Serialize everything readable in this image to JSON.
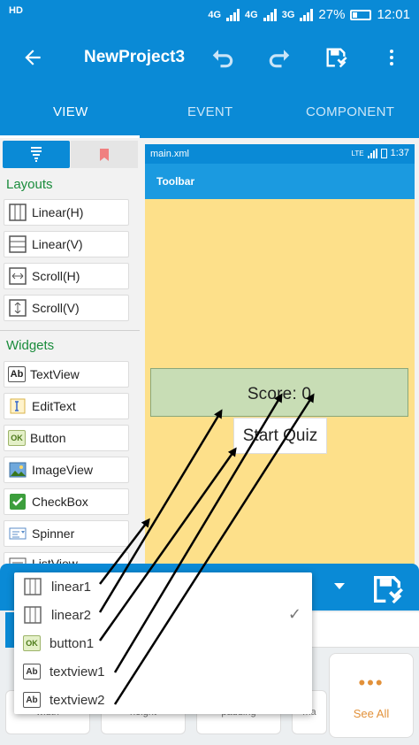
{
  "status_bar": {
    "hd": "HD",
    "net1": "4G",
    "net2": "4G",
    "net3": "3G",
    "battery": "27%",
    "time": "12:01"
  },
  "toolbar": {
    "title": "NewProject3"
  },
  "tabs": [
    {
      "label": "VIEW"
    },
    {
      "label": "EVENT"
    },
    {
      "label": "COMPONENT"
    }
  ],
  "palette": {
    "layouts_title": "Layouts",
    "layouts": [
      {
        "label": "Linear(H)"
      },
      {
        "label": "Linear(V)"
      },
      {
        "label": "Scroll(H)"
      },
      {
        "label": "Scroll(V)"
      }
    ],
    "widgets_title": "Widgets",
    "widgets": [
      {
        "label": "TextView"
      },
      {
        "label": "EditText"
      },
      {
        "label": "Button"
      },
      {
        "label": "ImageView"
      },
      {
        "label": "CheckBox"
      },
      {
        "label": "Spinner"
      },
      {
        "label": "ListView"
      }
    ]
  },
  "preview": {
    "file": "main.xml",
    "status_net": "LTE",
    "time": "1:37",
    "toolbar": "Toolbar",
    "score_text": "Score:  0",
    "button_text": "Start Quiz"
  },
  "dropdown": {
    "items": [
      {
        "label": "linear1",
        "icon": "linear-h-icon"
      },
      {
        "label": "linear2",
        "icon": "linear-h-icon",
        "selected": true
      },
      {
        "label": "button1",
        "icon": "button-icon"
      },
      {
        "label": "textview1",
        "icon": "textview-icon"
      },
      {
        "label": "textview2",
        "icon": "textview-icon"
      }
    ]
  },
  "bottom": {
    "chips": [
      "width",
      "height",
      "padding",
      "ma"
    ],
    "see_all": "See All"
  },
  "colors": {
    "primary": "#0a8ad6",
    "accent_green": "#1a8c3c",
    "preview_bg": "#fde08a",
    "score_bg": "#c8ddb5",
    "see_all": "#e2913a"
  }
}
